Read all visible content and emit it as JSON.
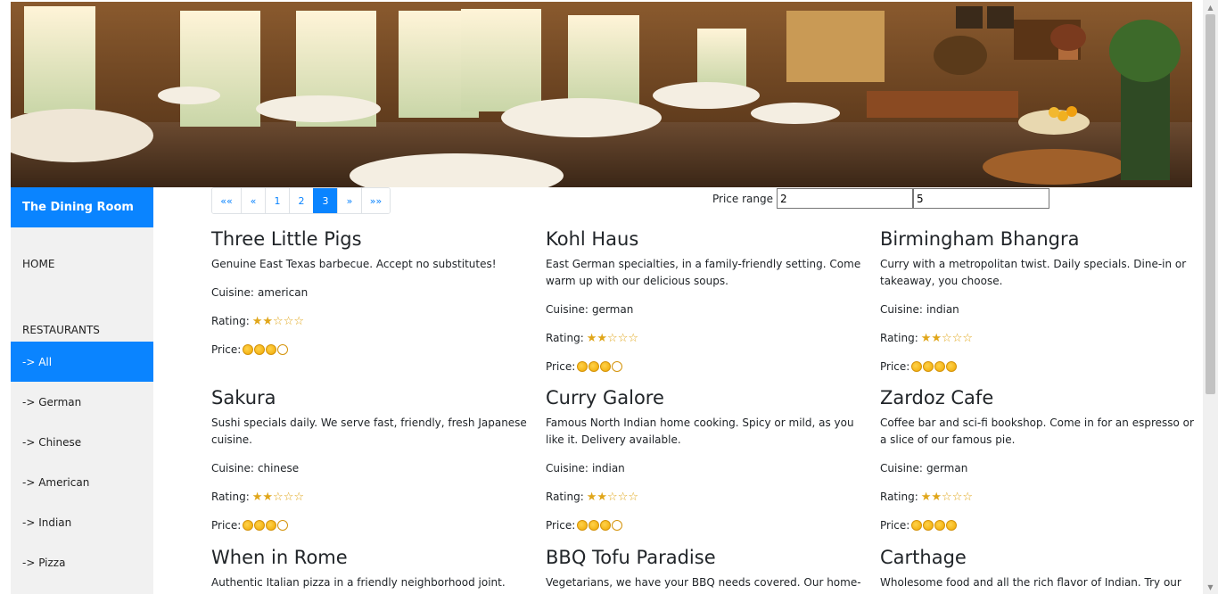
{
  "brand": "The Dining Room",
  "nav": {
    "home": "HOME",
    "restaurants": "RESTAURANTS",
    "items": [
      {
        "label": "-> All",
        "active": true
      },
      {
        "label": "-> German",
        "active": false
      },
      {
        "label": "-> Chinese",
        "active": false
      },
      {
        "label": "-> American",
        "active": false
      },
      {
        "label": "-> Indian",
        "active": false
      },
      {
        "label": "-> Pizza",
        "active": false
      }
    ]
  },
  "pagination": {
    "first": "««",
    "prev": "«",
    "pages": [
      "1",
      "2",
      "3"
    ],
    "active_page": "3",
    "next": "»",
    "last": "»»"
  },
  "price_range": {
    "label": "Price range",
    "min": "2",
    "max": "5"
  },
  "labels": {
    "cuisine": "Cuisine:",
    "rating": "Rating:",
    "price": "Price:"
  },
  "restaurants": [
    {
      "name": "Three Little Pigs",
      "description": "Genuine East Texas barbecue. Accept no substitutes!",
      "cuisine": "american",
      "rating": 2,
      "price": 3
    },
    {
      "name": "Kohl Haus",
      "description": "East German specialties, in a family-friendly setting. Come warm up with our delicious soups.",
      "cuisine": "german",
      "rating": 2,
      "price": 3
    },
    {
      "name": "Birmingham Bhangra",
      "description": "Curry with a metropolitan twist. Daily specials. Dine-in or takeaway, you choose.",
      "cuisine": "indian",
      "rating": 2,
      "price": 4
    },
    {
      "name": "Sakura",
      "description": "Sushi specials daily. We serve fast, friendly, fresh Japanese cuisine.",
      "cuisine": "chinese",
      "rating": 2,
      "price": 3
    },
    {
      "name": "Curry Galore",
      "description": "Famous North Indian home cooking. Spicy or mild, as you like it. Delivery available.",
      "cuisine": "indian",
      "rating": 2,
      "price": 3
    },
    {
      "name": "Zardoz Cafe",
      "description": "Coffee bar and sci-fi bookshop. Come in for an espresso or a slice of our famous pie.",
      "cuisine": "german",
      "rating": 2,
      "price": 4
    },
    {
      "name": "When in Rome",
      "description": "Authentic Italian pizza in a friendly neighborhood joint.",
      "cuisine": "",
      "rating": 0,
      "price": 0
    },
    {
      "name": "BBQ Tofu Paradise",
      "description": "Vegetarians, we have your BBQ needs covered. Our home-",
      "cuisine": "",
      "rating": 0,
      "price": 0
    },
    {
      "name": "Carthage",
      "description": "Wholesome food and all the rich flavor of Indian. Try our",
      "cuisine": "",
      "rating": 0,
      "price": 0
    }
  ],
  "max_stars": 5,
  "max_price": 4,
  "colors": {
    "accent": "#0a84ff",
    "sidebar_bg": "#f1f1f1",
    "star": "#e0a61a",
    "coin": "#f0a800"
  }
}
